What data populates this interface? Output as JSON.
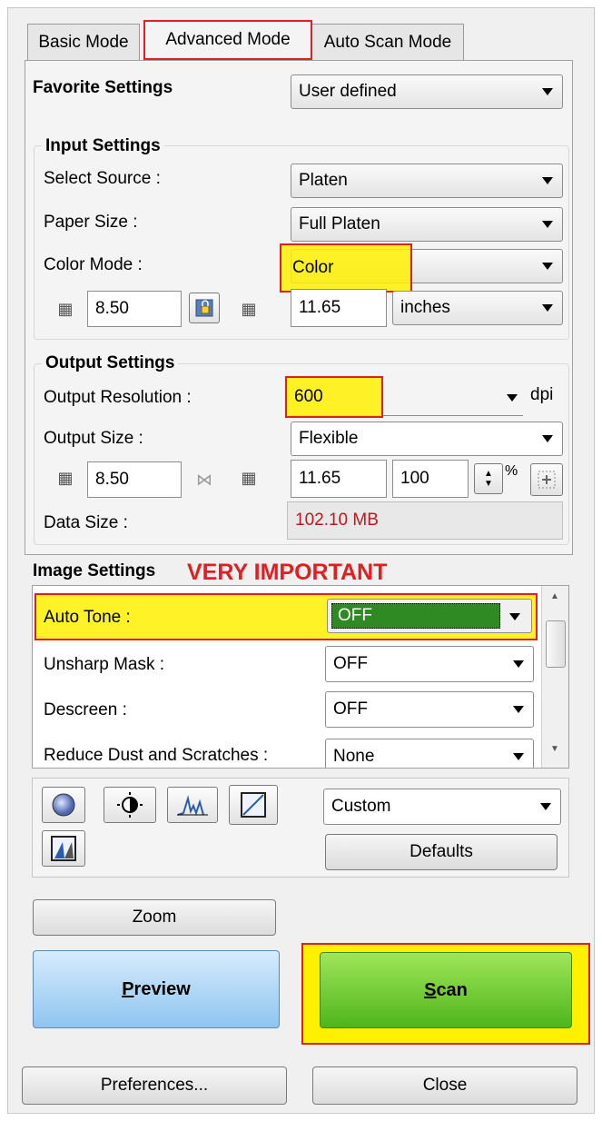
{
  "tabs": [
    "Basic Mode",
    "Advanced Mode",
    "Auto Scan Mode"
  ],
  "favorite": {
    "label": "Favorite Settings",
    "value": "User defined"
  },
  "input": {
    "title": "Input Settings",
    "source_label": "Select Source :",
    "source_value": "Platen",
    "paper_label": "Paper Size :",
    "paper_value": "Full Platen",
    "color_label": "Color Mode :",
    "color_value": "Color",
    "width": "8.50",
    "height": "11.65",
    "unit": "inches"
  },
  "output": {
    "title": "Output Settings",
    "res_label": "Output Resolution :",
    "res_value": "600",
    "res_unit": "dpi",
    "size_label": "Output Size :",
    "size_value": "Flexible",
    "width": "8.50",
    "height": "11.65",
    "scale": "100",
    "scale_unit": "%",
    "data_label": "Data Size :",
    "data_value": "102.10 MB"
  },
  "image": {
    "title": "Image Settings",
    "note": "VERY IMPORTANT",
    "rows": [
      {
        "label": "Auto Tone :",
        "value": "OFF"
      },
      {
        "label": "Unsharp Mask :",
        "value": "OFF"
      },
      {
        "label": "Descreen :",
        "value": "OFF"
      },
      {
        "label": "Reduce Dust and Scratches :",
        "value": "None"
      }
    ]
  },
  "adjust": {
    "preset": "Custom",
    "defaults": "Defaults"
  },
  "buttons": {
    "zoom": "Zoom",
    "preview_accel": "P",
    "preview_rest": "review",
    "scan_accel": "S",
    "scan_rest": "can",
    "preferences": "Preferences...",
    "close": "Close"
  },
  "colors": {
    "highlight": "#fff000",
    "highlight_border": "#e02020",
    "note": "#e02020",
    "data_size": "#c01818",
    "auto_tone_value_bg": "#2f8a23",
    "preview_bg": "#a9d3f5",
    "scan_bg": "#6fd130"
  }
}
